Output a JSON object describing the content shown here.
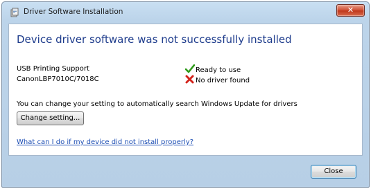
{
  "window": {
    "title": "Driver Software Installation"
  },
  "titlebar": {
    "close_glyph": "✕",
    "close_color": "#c7432a"
  },
  "dialog": {
    "heading": "Device driver software was not successfully installed",
    "heading_color": "#1e3c8c",
    "devices": [
      {
        "name": "USB Printing Support",
        "status": "Ready to use",
        "status_icon": "green-check-icon"
      },
      {
        "name": "CanonLBP7010C/7018C",
        "status": "No driver found",
        "status_icon": "red-x-icon"
      }
    ],
    "info_text": "You can change your setting to automatically search Windows Update for drivers",
    "change_button": "Change setting...",
    "help_link": "What can I do if my device did not install properly?",
    "link_color": "#1a4cb3"
  },
  "footer": {
    "close_button": "Close"
  }
}
